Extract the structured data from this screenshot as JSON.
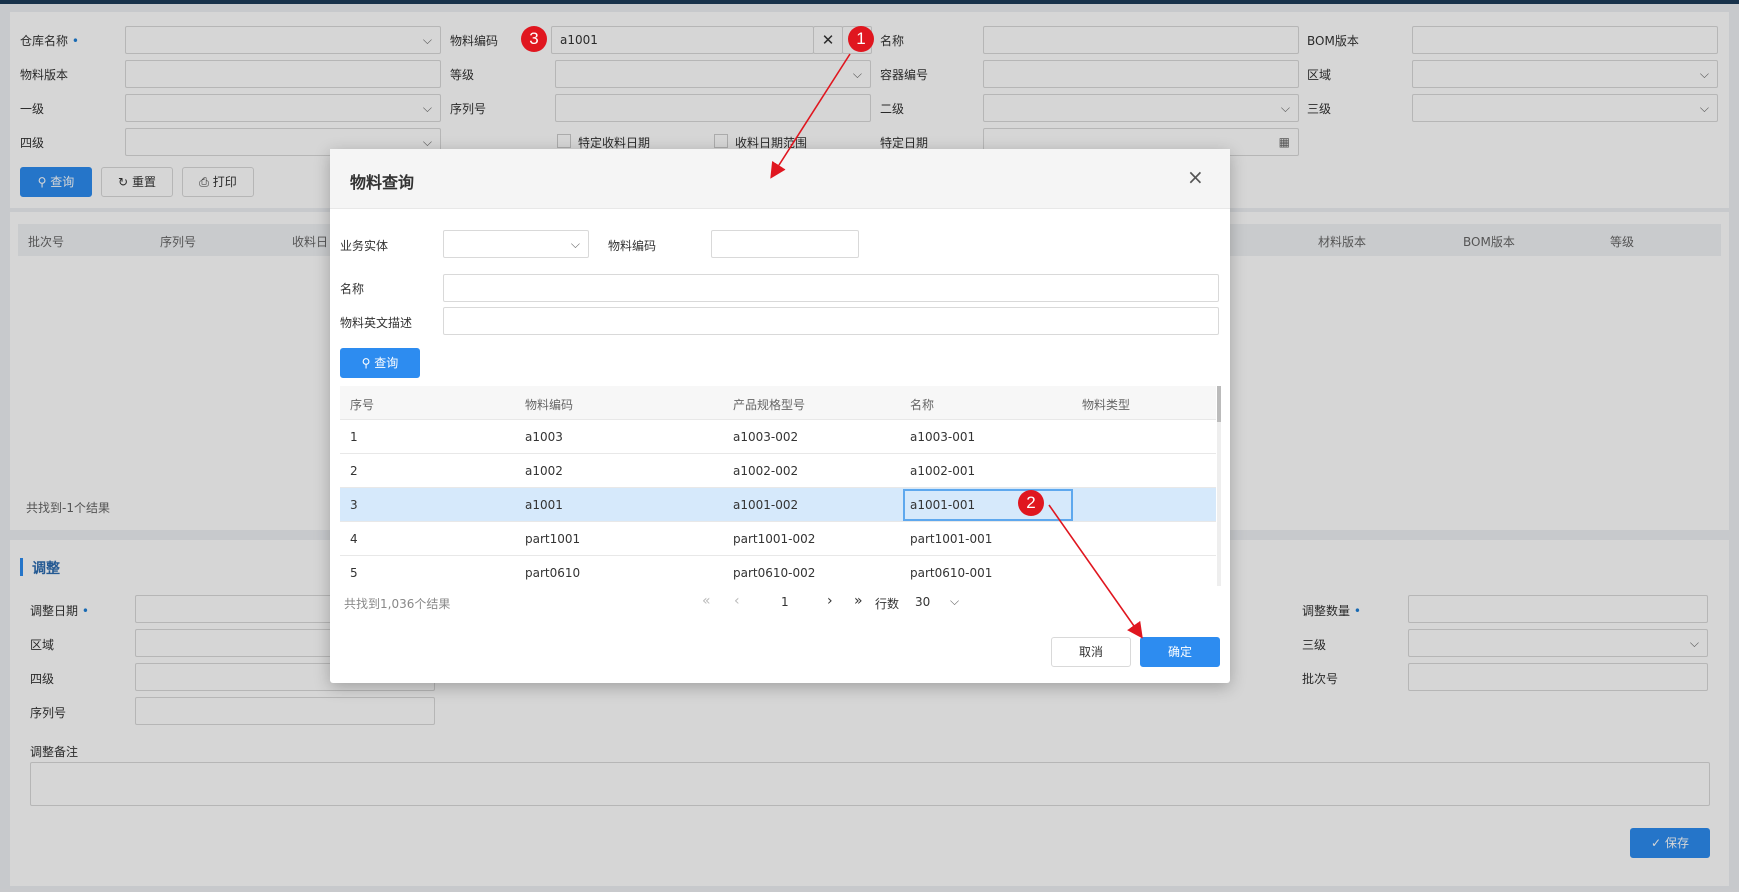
{
  "form": {
    "warehouse_name": "仓库名称",
    "material_code": "物料编码",
    "material_code_value": "a1001",
    "name": "名称",
    "bom_version": "BOM版本",
    "material_version": "物料版本",
    "grade": "等级",
    "container_no": "容器编号",
    "area": "区域",
    "level1": "一级",
    "serial_no": "序列号",
    "level2": "二级",
    "level3": "三级",
    "level4": "四级",
    "specific_receive_date": "特定收料日期",
    "receive_date_range": "收料日期范围",
    "specific_date": "特定日期",
    "query_btn": "查询",
    "reset_btn": "重置",
    "print_btn": "打印"
  },
  "result_table": {
    "headers": [
      "批次号",
      "序列号",
      "收料日",
      "材料版本",
      "BOM版本",
      "等级"
    ],
    "footer": "共找到-1个结果"
  },
  "adjust": {
    "title": "调整",
    "adjust_date": "调整日期",
    "adjust_qty": "调整数量",
    "area": "区域",
    "level3": "三级",
    "level4": "四级",
    "batch_no": "批次号",
    "serial_no": "序列号",
    "remark": "调整备注",
    "save_btn": "保存"
  },
  "modal": {
    "title": "物料查询",
    "close": "×",
    "business_entity": "业务实体",
    "material_code": "物料编码",
    "name": "名称",
    "en_desc": "物料英文描述",
    "query_btn": "查询",
    "columns": [
      "序号",
      "物料编码",
      "产品规格型号",
      "名称",
      "物料类型"
    ],
    "rows": [
      {
        "no": "1",
        "code": "a1003",
        "spec": "a1003-002",
        "name": "a1003-001",
        "type": ""
      },
      {
        "no": "2",
        "code": "a1002",
        "spec": "a1002-002",
        "name": "a1002-001",
        "type": ""
      },
      {
        "no": "3",
        "code": "a1001",
        "spec": "a1001-002",
        "name": "a1001-001",
        "type": ""
      },
      {
        "no": "4",
        "code": "part1001",
        "spec": "part1001-002",
        "name": "part1001-001",
        "type": ""
      },
      {
        "no": "5",
        "code": "part0610",
        "spec": "part0610-002",
        "name": "part0610-001",
        "type": ""
      }
    ],
    "total": "共找到1,036个结果",
    "page": "1",
    "rows_label": "行数",
    "rows_per_page": "30",
    "cancel_btn": "取消",
    "ok_btn": "确定"
  },
  "annotations": {
    "b1": "1",
    "b2": "2",
    "b3": "3"
  },
  "colors": {
    "primary": "#2d8cf0",
    "annotation": "#e0161f",
    "selected_row": "#d6e9fb"
  }
}
